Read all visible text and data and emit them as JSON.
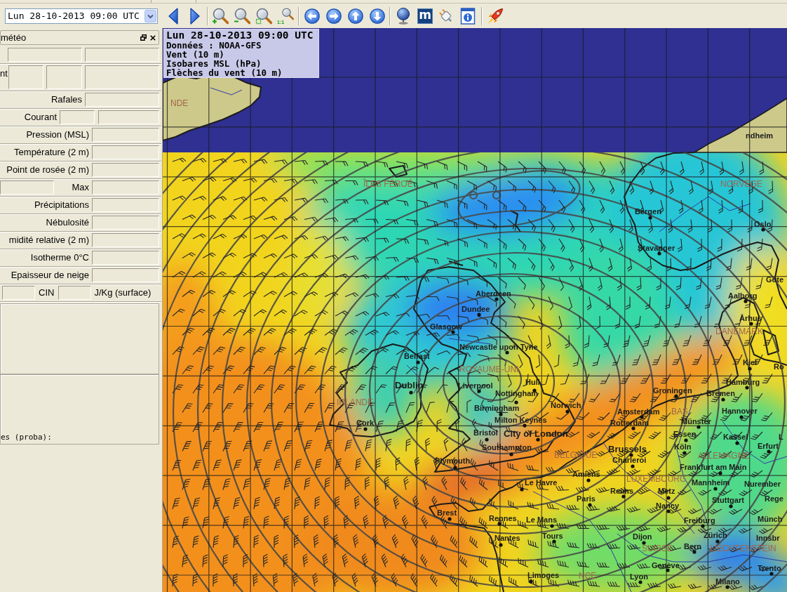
{
  "toolbar": {
    "date_select": {
      "value": "Lun 28-10-2013 09:00 UTC"
    },
    "zoom_actual_label": "1:1",
    "logo_button_label": "m"
  },
  "dock": {
    "title": "météo",
    "rows": [
      {
        "kind": "pair"
      },
      {
        "kind": "triple",
        "label": "nt"
      },
      {
        "kind": "single_wide",
        "label": "Rafales"
      },
      {
        "kind": "double",
        "label": "Courant"
      },
      {
        "kind": "single",
        "label": "Pression (MSL)"
      },
      {
        "kind": "single",
        "label": "Température (2 m)"
      },
      {
        "kind": "single",
        "label": "Point de rosée (2 m)"
      },
      {
        "kind": "max",
        "label": "Max"
      },
      {
        "kind": "single",
        "label": "Précipitations"
      },
      {
        "kind": "single",
        "label": "Nébulosité"
      },
      {
        "kind": "single",
        "label": "midité relative (2 m)"
      },
      {
        "kind": "single",
        "label": "Isotherme 0°C"
      },
      {
        "kind": "single",
        "label": "Epaisseur de neige"
      },
      {
        "kind": "cin",
        "label": "CIN",
        "unit": "J/Kg (surface)"
      }
    ],
    "proba_label": "es (proba):"
  },
  "map": {
    "legend": {
      "date": "Lun 28-10-2013 09:00 UTC",
      "lines": [
        "Données : NOAA-GFS",
        "Vent (10 m)",
        "Isobares MSL (hPa)",
        "Flèches du vent (10 m)"
      ]
    },
    "countries": [
      "NDE",
      "ÎLES FÉROÉ",
      "NORVÈGE",
      "DANEMARK",
      "ROYAUME-UNI",
      "IRLANDE",
      "BAS",
      "BELGIQUE",
      "ALLEMAGNE",
      "LUXEMBOURG",
      "SUISSE",
      "LIECHTENSTEIN",
      "NCE"
    ],
    "cities": [
      "ndheim",
      "Bergen",
      "Oslo",
      "Stavanger",
      "Göte",
      "Aberdeen",
      "Aalborg",
      "Dundee",
      "Århus",
      "Glasgow",
      "Newcastle upon Tyne",
      "Belfast",
      "Kiel",
      "Ro",
      "Dublin",
      "Liverpool",
      "Hull",
      "Hamburg",
      "Nottingham",
      "Groningen",
      "Bremen",
      "Birmingham",
      "Norwich",
      "Amsterdam",
      "Hannover",
      "Cork",
      "Milton Keynes",
      "Rotterdam",
      "Münster",
      "Bristol",
      "City of London",
      "Essen",
      "Kassel",
      "L",
      "Southampton",
      "Brussels",
      "Köln",
      "Erfurt",
      "Plymouth",
      "Charleroi",
      "Frankfurt am Main",
      "Amiens",
      "Le Havre",
      "Mannheim",
      "Nurember",
      "Reims",
      "Metz",
      "Paris",
      "Stuttgart",
      "Rege",
      "Nancy",
      "Brest",
      "Rennes",
      "Le Mans",
      "Freiburg",
      "Münch",
      "Nantes",
      "Tours",
      "Dijon",
      "Zürich",
      "Innsbr",
      "Bern",
      "Genève",
      "Trento",
      "Limoges",
      "Lyon",
      "Milano"
    ]
  }
}
